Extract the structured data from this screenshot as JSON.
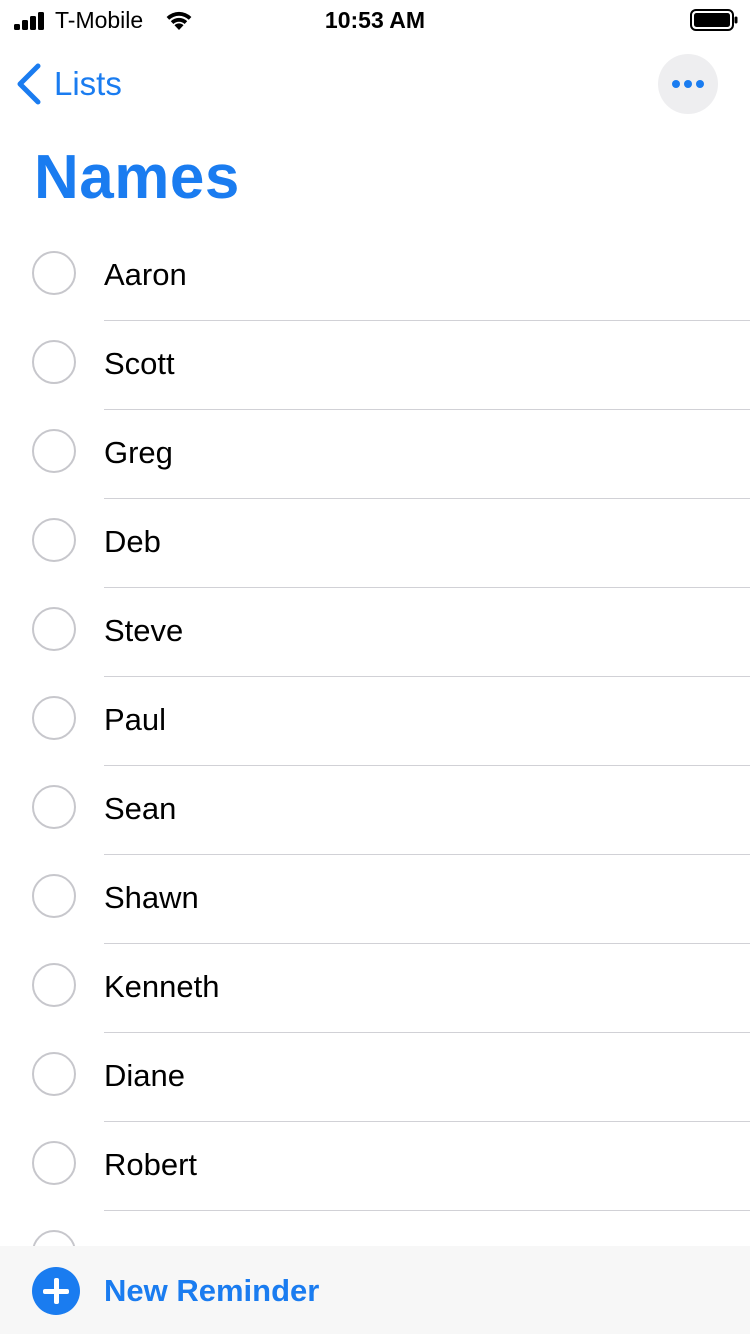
{
  "status_bar": {
    "carrier": "T-Mobile",
    "time": "10:53 AM",
    "signal_icon": "cellular-signal-icon",
    "wifi_icon": "wifi-icon",
    "battery_icon": "battery-icon"
  },
  "nav": {
    "back_label": "Lists",
    "back_icon": "chevron-left-icon",
    "more_icon": "ellipsis-icon"
  },
  "title": "Names",
  "items": [
    {
      "label": "Aaron"
    },
    {
      "label": "Scott"
    },
    {
      "label": "Greg"
    },
    {
      "label": "Deb"
    },
    {
      "label": "Steve"
    },
    {
      "label": "Paul"
    },
    {
      "label": "Sean"
    },
    {
      "label": "Shawn"
    },
    {
      "label": "Kenneth"
    },
    {
      "label": "Diane"
    },
    {
      "label": "Robert"
    }
  ],
  "toolbar": {
    "new_reminder_label": "New Reminder",
    "new_reminder_icon": "plus-circle-icon"
  },
  "colors": {
    "accent": "#1a7cf0",
    "checkbox_border": "#c7c7cc",
    "separator": "#d1d1d6",
    "toolbar_background": "#f7f7f7"
  }
}
